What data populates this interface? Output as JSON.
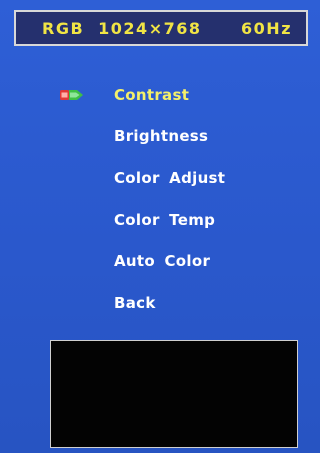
{
  "status": {
    "signal": "RGB",
    "resolution": "1024×768",
    "refresh": "60Hz"
  },
  "menu": {
    "items": [
      {
        "label": "Contrast",
        "selected": true
      },
      {
        "label": "Brightness",
        "selected": false
      },
      {
        "label": "Color Adjust",
        "selected": false
      },
      {
        "label": "Color Temp",
        "selected": false
      },
      {
        "label": "Auto Color",
        "selected": false
      },
      {
        "label": "Back",
        "selected": false
      }
    ],
    "pointer_icon": "selection-pointer-icon"
  },
  "colors": {
    "background": "#2a58cc",
    "status_bar": "#25306e",
    "status_text": "#f0e445",
    "menu_text": "#ffffff",
    "preview": "#030303"
  }
}
